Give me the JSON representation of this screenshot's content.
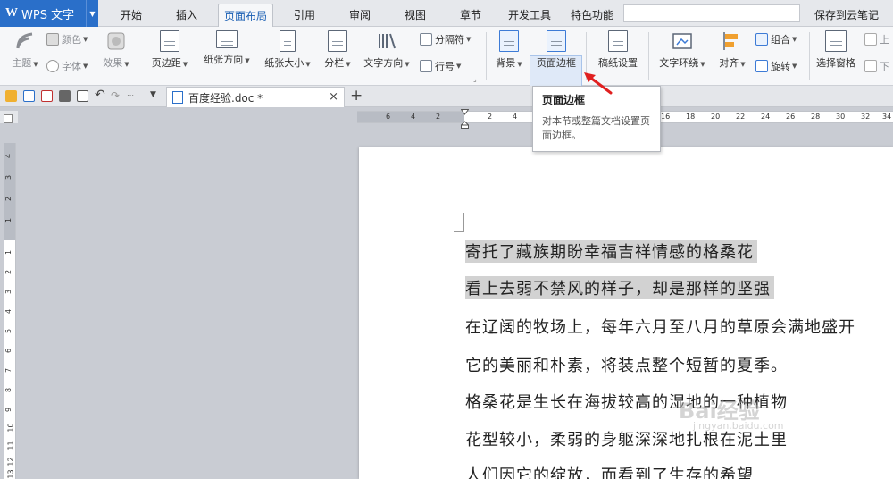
{
  "app": {
    "logo": "W",
    "name": "WPS 文字"
  },
  "menu": {
    "tabs": [
      "开始",
      "插入",
      "页面布局",
      "引用",
      "审阅",
      "视图",
      "章节",
      "开发工具",
      "特色功能"
    ],
    "active": "页面布局",
    "save_cloud": "保存到云笔记"
  },
  "ribbon": {
    "theme": "主题",
    "color": "颜色",
    "font": "字体",
    "effect": "效果",
    "margins": "页边距",
    "orientation": "纸张方向",
    "size": "纸张大小",
    "columns": "分栏",
    "text_direction": "文字方向",
    "breaks": "分隔符",
    "line_numbers": "行号",
    "background": "背景",
    "page_border": "页面边框",
    "manuscript": "稿纸设置",
    "text_wrap": "文字环绕",
    "align": "对齐",
    "group": "组合",
    "rotate": "旋转",
    "selection_pane": "选择窗格",
    "bring_forward": "上",
    "send_backward": "下"
  },
  "tooltip": {
    "title": "页面边框",
    "description": "对本节或整篇文档设置页面边框。"
  },
  "doc_tab": {
    "name": "百度经验.doc *"
  },
  "ruler": {
    "h_numbers": [
      "6",
      "4",
      "2",
      "2",
      "4",
      "6",
      "8",
      "10",
      "12",
      "14",
      "16",
      "18",
      "20",
      "22",
      "24",
      "26",
      "28",
      "30",
      "32",
      "34"
    ],
    "v_numbers": [
      "4",
      "3",
      "2",
      "1",
      "1",
      "2",
      "3",
      "4",
      "5",
      "6",
      "7",
      "8",
      "9",
      "10",
      "11",
      "12",
      "13"
    ]
  },
  "document": {
    "lines": [
      "寄托了藏族期盼幸福吉祥情感的格桑花",
      "看上去弱不禁风的样子，却是那样的坚强",
      "在辽阔的牧场上，每年六月至八月的草原会满地盛开",
      "它的美丽和朴素，将装点整个短暂的夏季。",
      "格桑花是生长在海拔较高的湿地的一种植物",
      "花型较小，柔弱的身躯深深地扎根在泥土里",
      "人们因它的绽放，而看到了生存的希望"
    ],
    "selected_lines": 2
  },
  "watermark": {
    "text": "Bai经验",
    "url": "jingyan.baidu.com"
  },
  "colors": {
    "accent": "#2a6fc9",
    "selection": "#d2d2d2",
    "arrow": "#e02020"
  }
}
